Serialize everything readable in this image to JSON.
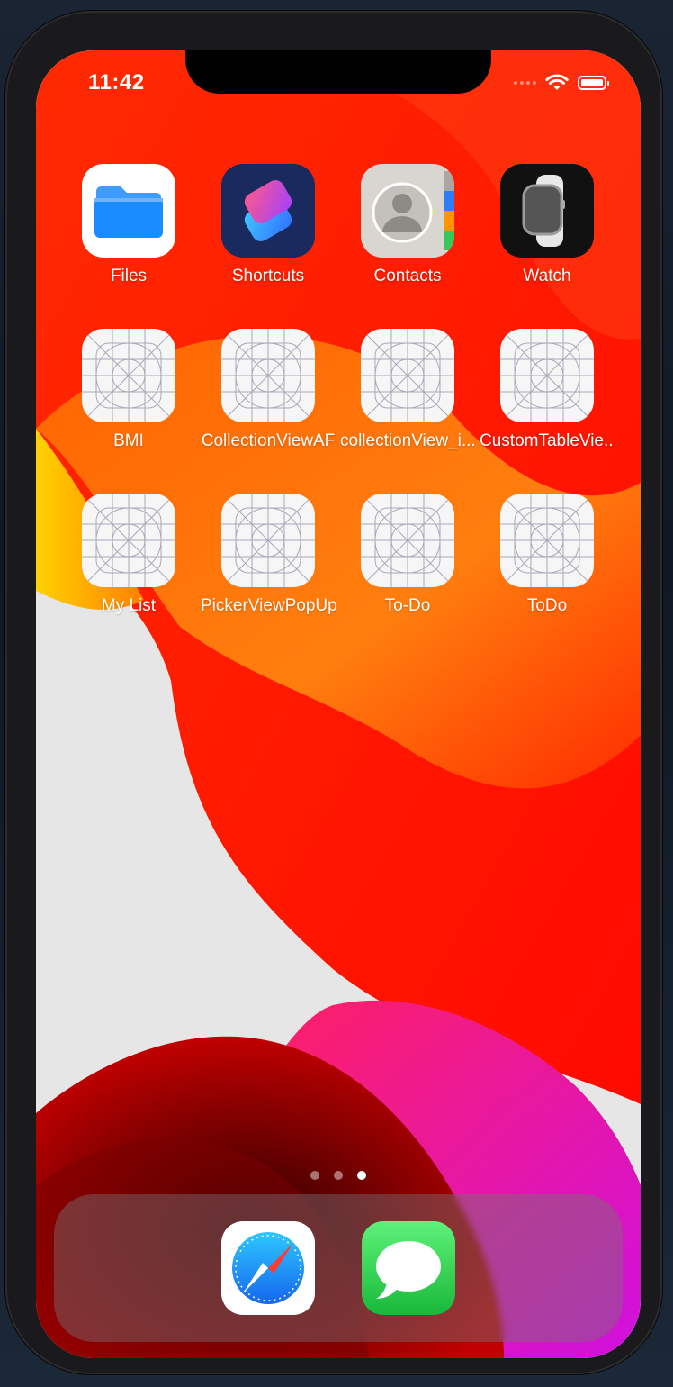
{
  "status_bar": {
    "time": "11:42"
  },
  "home_screen": {
    "apps": [
      {
        "label": "Files",
        "icon": "files-icon"
      },
      {
        "label": "Shortcuts",
        "icon": "shortcuts-icon"
      },
      {
        "label": "Contacts",
        "icon": "contacts-icon"
      },
      {
        "label": "Watch",
        "icon": "watch-icon"
      },
      {
        "label": "BMI",
        "icon": "placeholder-app-icon"
      },
      {
        "label": "CollectionViewAF",
        "icon": "placeholder-app-icon"
      },
      {
        "label": "collectionView_i...",
        "icon": "placeholder-app-icon"
      },
      {
        "label": "CustomTableVie...",
        "icon": "placeholder-app-icon"
      },
      {
        "label": "My List",
        "icon": "placeholder-app-icon"
      },
      {
        "label": "PickerViewPopUp",
        "icon": "placeholder-app-icon"
      },
      {
        "label": "To-Do",
        "icon": "placeholder-app-icon"
      },
      {
        "label": "ToDo",
        "icon": "placeholder-app-icon"
      }
    ],
    "page_indicator": {
      "pages": 3,
      "current": 3
    }
  },
  "dock": {
    "apps": [
      {
        "icon": "safari-icon"
      },
      {
        "icon": "messages-icon"
      }
    ]
  },
  "colors": {
    "wallpaper_red": "#ff1a00",
    "wallpaper_orange": "#ff7a00",
    "wallpaper_magenta": "#e020e0",
    "accent_blue": "#1a8cff",
    "messages_green": "#34c759"
  }
}
